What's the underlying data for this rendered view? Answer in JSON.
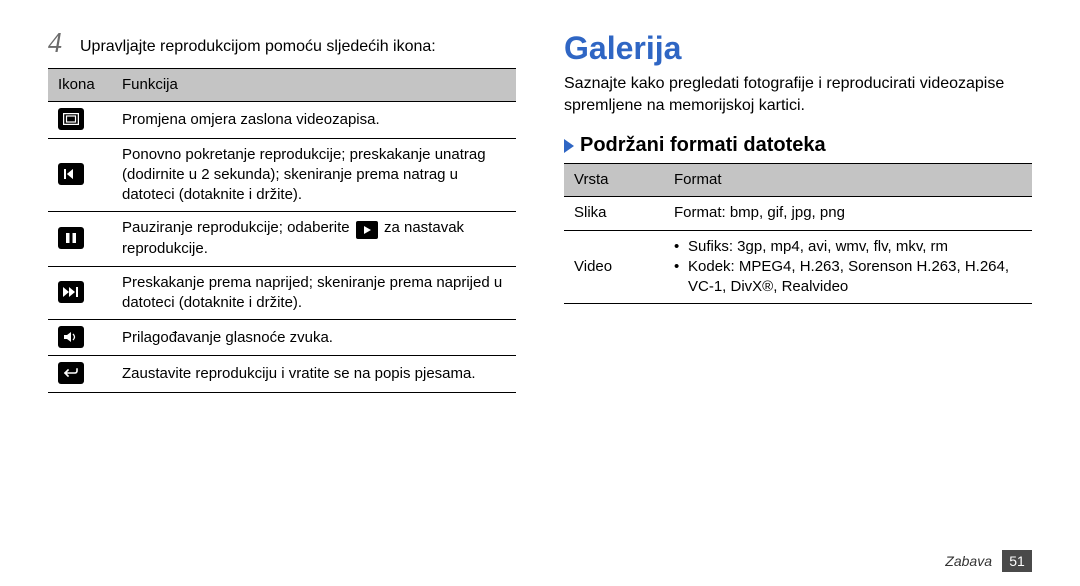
{
  "left": {
    "step_number": "4",
    "step_text": "Upravljajte reprodukcijom pomoću sljedećih ikona:",
    "table": {
      "headers": {
        "icon": "Ikona",
        "func": "Funkcija"
      },
      "rows": [
        {
          "icon": "ratio-icon",
          "text": "Promjena omjera zaslona videozapisa."
        },
        {
          "icon": "prev-icon",
          "text": "Ponovno pokretanje reprodukcije; preskakanje unatrag (dodirnite u 2 sekunda); skeniranje prema natrag u datoteci (dotaknite i držite)."
        },
        {
          "icon": "pause-icon",
          "text_before": "Pauziranje reprodukcije; odaberite ",
          "text_after": " za nastavak reprodukcije."
        },
        {
          "icon": "next-icon",
          "text": "Preskakanje prema naprijed; skeniranje prema naprijed u datoteci (dotaknite i držite)."
        },
        {
          "icon": "volume-icon",
          "text": "Prilagođavanje glasnoće zvuka."
        },
        {
          "icon": "back-icon",
          "text": "Zaustavite reprodukciju i vratite se na popis pjesama."
        }
      ]
    }
  },
  "right": {
    "title": "Galerija",
    "intro": "Saznajte kako pregledati fotografije i reproducirati videozapise spremljene na memorijskoj kartici.",
    "subheading": "Podržani formati datoteka",
    "table": {
      "headers": {
        "type": "Vrsta",
        "format": "Format"
      },
      "rows": {
        "image": {
          "type": "Slika",
          "format": "Format: bmp, gif, jpg, png"
        },
        "video": {
          "type": "Video",
          "bullets": [
            "Sufiks: 3gp, mp4, avi, wmv, flv, mkv, rm",
            "Kodek: MPEG4, H.263, Sorenson H.263, H.264, VC-1, DivX®, Realvideo"
          ]
        }
      }
    }
  },
  "footer": {
    "section": "Zabava",
    "page": "51"
  }
}
